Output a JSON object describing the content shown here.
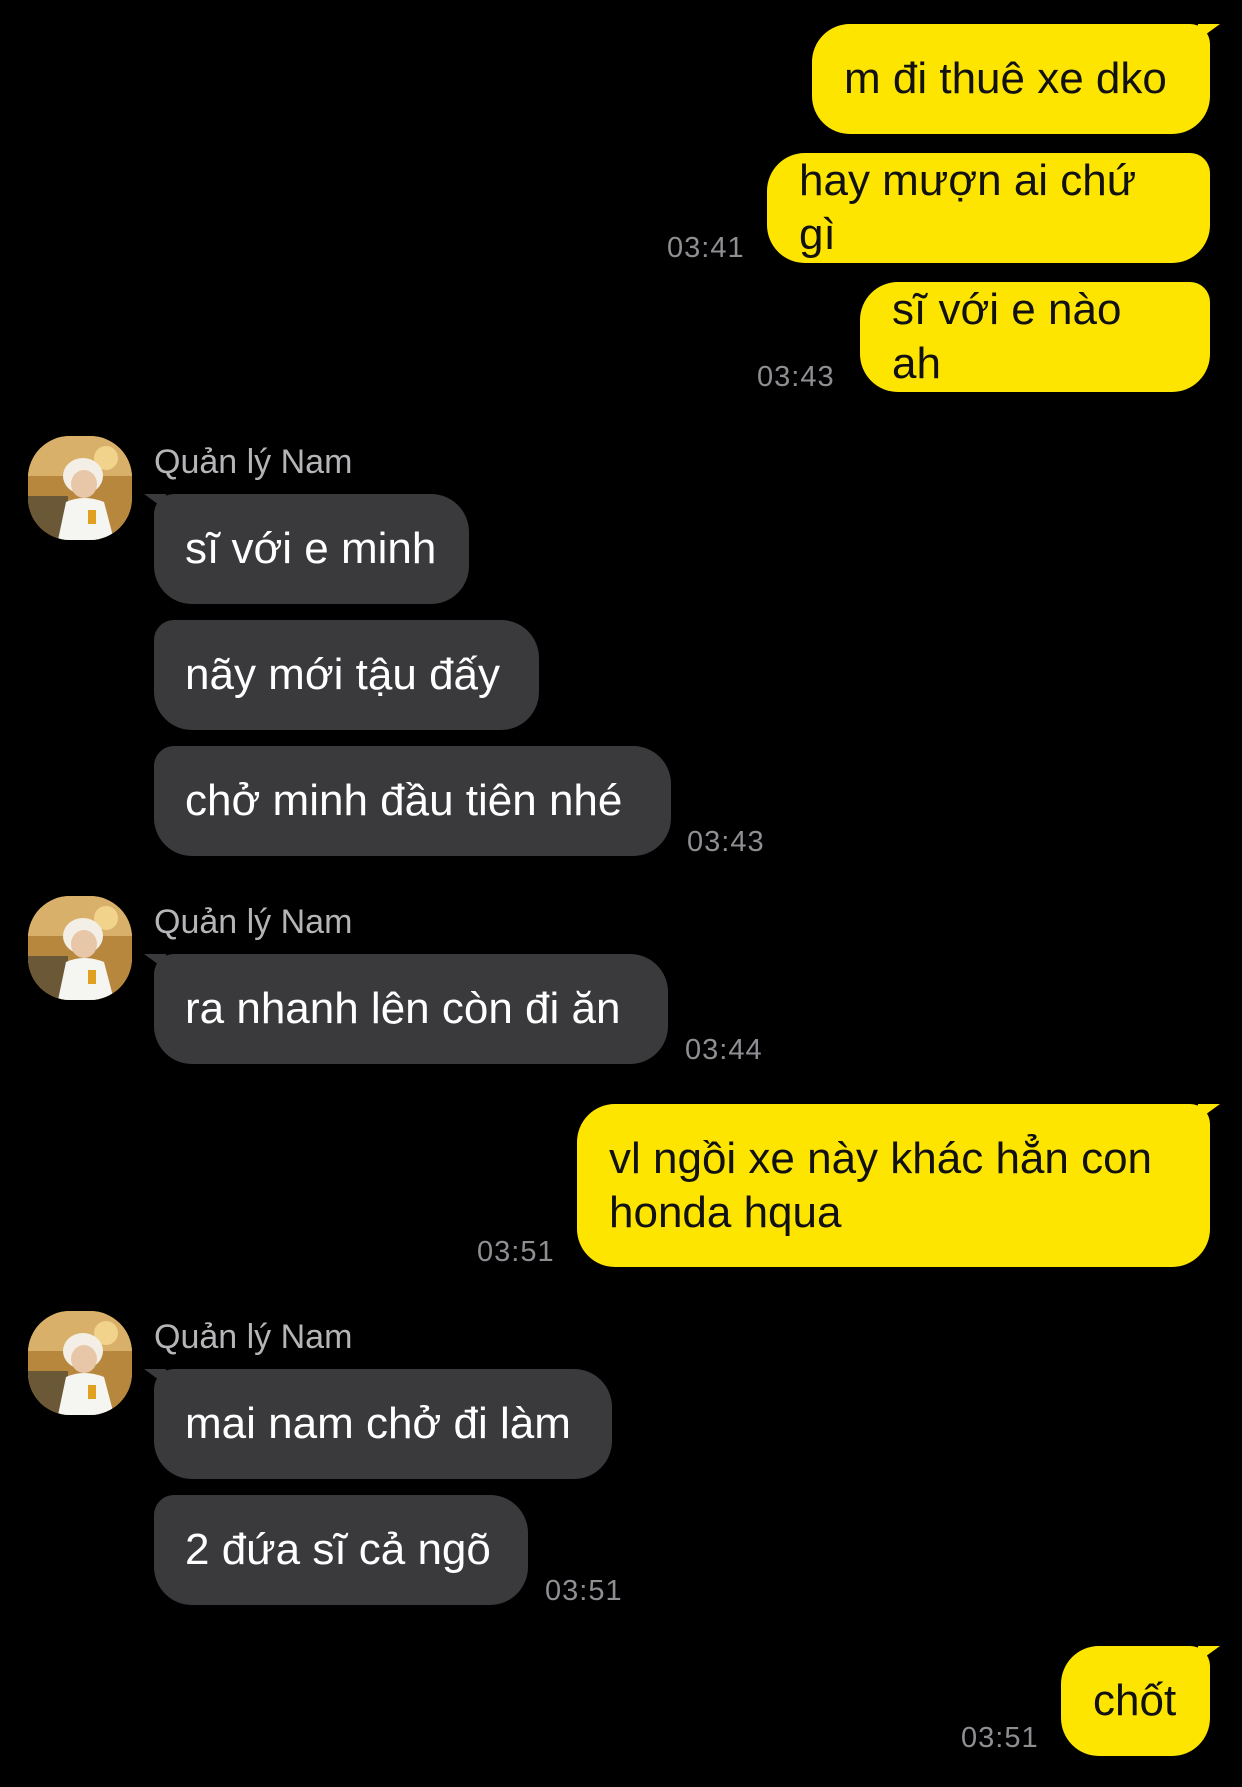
{
  "colors": {
    "background": "#000000",
    "outgoing_bubble": "#FEE500",
    "incoming_bubble": "#3A3A3C",
    "timestamp": "#8E8E93"
  },
  "messages": [
    {
      "direction": "out",
      "text": "m đi thuê xe dko"
    },
    {
      "direction": "out",
      "text": "hay mượn ai chứ gì",
      "time": "03:41"
    },
    {
      "direction": "out",
      "text": "sĩ với e nào ah",
      "time": "03:43"
    },
    {
      "direction": "in",
      "sender": "Quản lý Nam",
      "text": "sĩ với e minh"
    },
    {
      "direction": "in",
      "text": "nãy mới tậu đấy"
    },
    {
      "direction": "in",
      "text": "chở minh đầu tiên nhé",
      "time": "03:43"
    },
    {
      "direction": "in",
      "sender": "Quản lý Nam",
      "text": "ra nhanh lên còn đi ăn",
      "time": "03:44"
    },
    {
      "direction": "out",
      "text": "vl ngồi xe này khác hẳn con\nhonda hqua",
      "time": "03:51"
    },
    {
      "direction": "in",
      "sender": "Quản lý Nam",
      "text": "mai nam chở đi làm"
    },
    {
      "direction": "in",
      "text": "2 đứa sĩ cả ngõ",
      "time": "03:51"
    },
    {
      "direction": "out",
      "text": "chốt",
      "time": "03:51"
    }
  ]
}
